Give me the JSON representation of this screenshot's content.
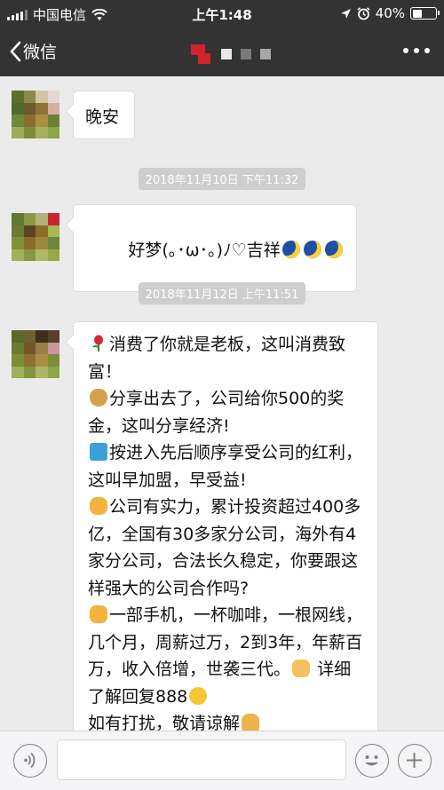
{
  "status_bar": {
    "carrier": "中国电信",
    "time": "上午1:48",
    "battery": "40%",
    "battery_level": 0.4
  },
  "nav": {
    "back_label": "微信",
    "contact_name_pixelated": true
  },
  "messages": [
    {
      "type": "text",
      "text": "晚安"
    },
    {
      "type": "timestamp",
      "text": "2018年11月10日 下午11:32"
    },
    {
      "type": "text",
      "text": "好梦(｡･ω･｡)ﾉ♡吉祥"
    },
    {
      "type": "timestamp",
      "text": "2018年11月12日 上午11:51"
    },
    {
      "type": "long_text",
      "paragraphs": [
        "消费了你就是老板，这叫消费致富！",
        "分享出去了，公司给你500的奖金，这叫分享经济!",
        "按进入先后顺序享受公司的红利，这叫早加盟，早受益!",
        "公司有实力，累计投资超过400多亿，全国有30多家分公司，海外有4家分公司，合法长久稳定，你要跟这样强大的公司合作吗?",
        "一部手机，一杯咖啡，一根网线，几个月，周薪过万，2到3年，年薪百万，收入倍增，世袭三代。",
        "详细了解回复888",
        "如有打扰，敬请谅解"
      ]
    }
  ],
  "icons": {
    "back": "chevron-left-icon",
    "more": "more-dots-icon",
    "voice": "voice-icon",
    "emoji": "emoji-icon",
    "plus": "plus-icon"
  },
  "colors": {
    "header_bg": "#333333",
    "chat_bg": "#ebebeb",
    "bubble_bg": "#ffffff",
    "timestamp_bg": "#cecece"
  }
}
